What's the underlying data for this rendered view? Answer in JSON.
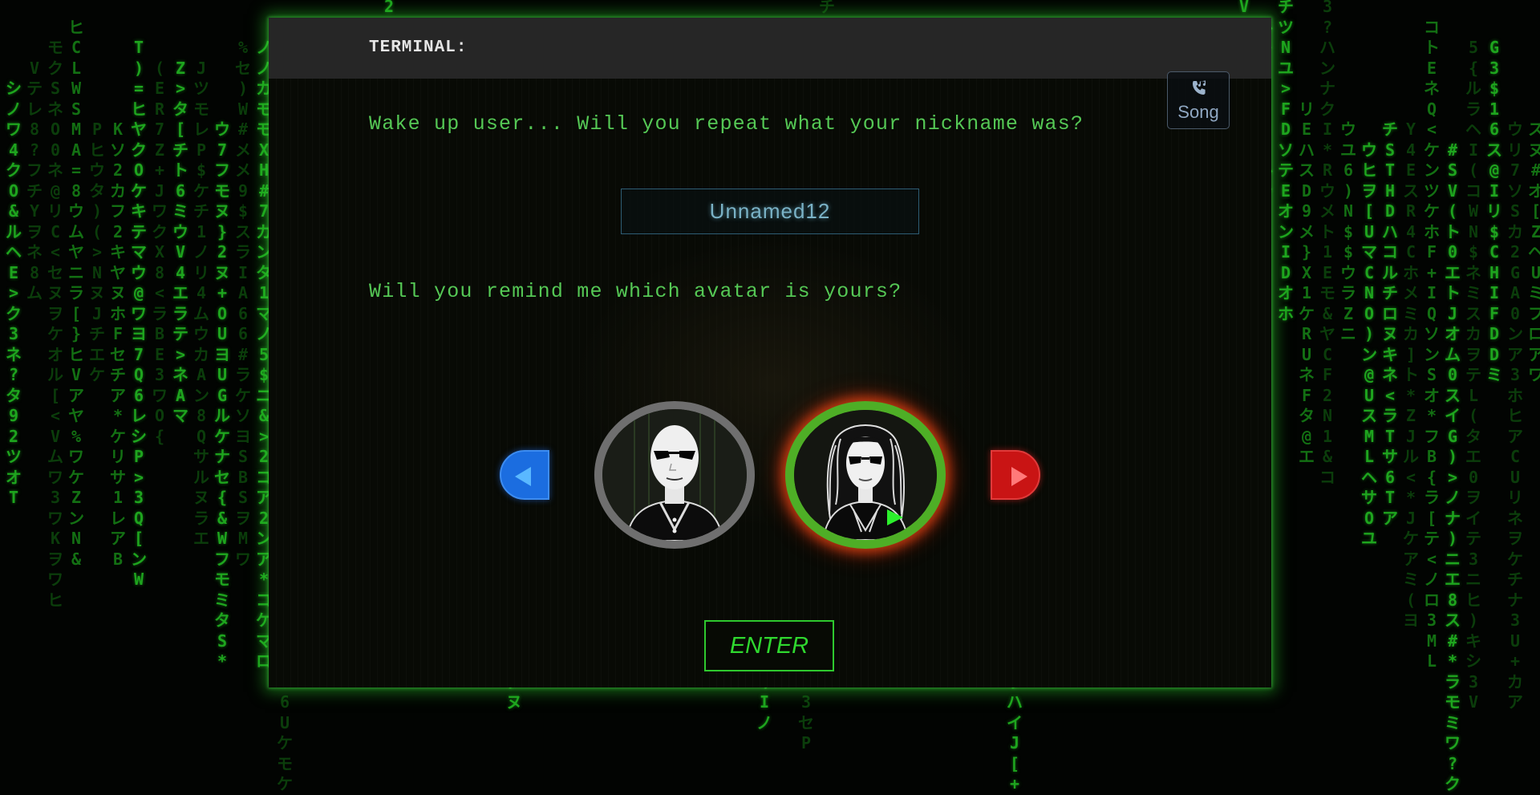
{
  "terminal": {
    "title": "TERMINAL:",
    "song_button": {
      "label": "Song",
      "icon": "phone-music-icon"
    },
    "prompt_nickname": "Wake up user... Will you repeat what your nickname was?",
    "nickname_value": "Unnamed12",
    "prompt_avatar": "Will you remind me which avatar is yours?",
    "avatars": [
      {
        "name": "male-avatar",
        "selected": false,
        "ring_color": "#6f6f6f"
      },
      {
        "name": "female-avatar",
        "selected": true,
        "ring_color": "#4eae26"
      }
    ],
    "prev_icon": "arrow-left-icon",
    "next_icon": "arrow-right-icon",
    "enter_label": "ENTER"
  },
  "colors": {
    "accent_green": "#2fd82f",
    "prompt_green": "#55c855",
    "prev_blue": "#1b6de0",
    "next_red": "#c91414",
    "header": "#262626"
  }
}
